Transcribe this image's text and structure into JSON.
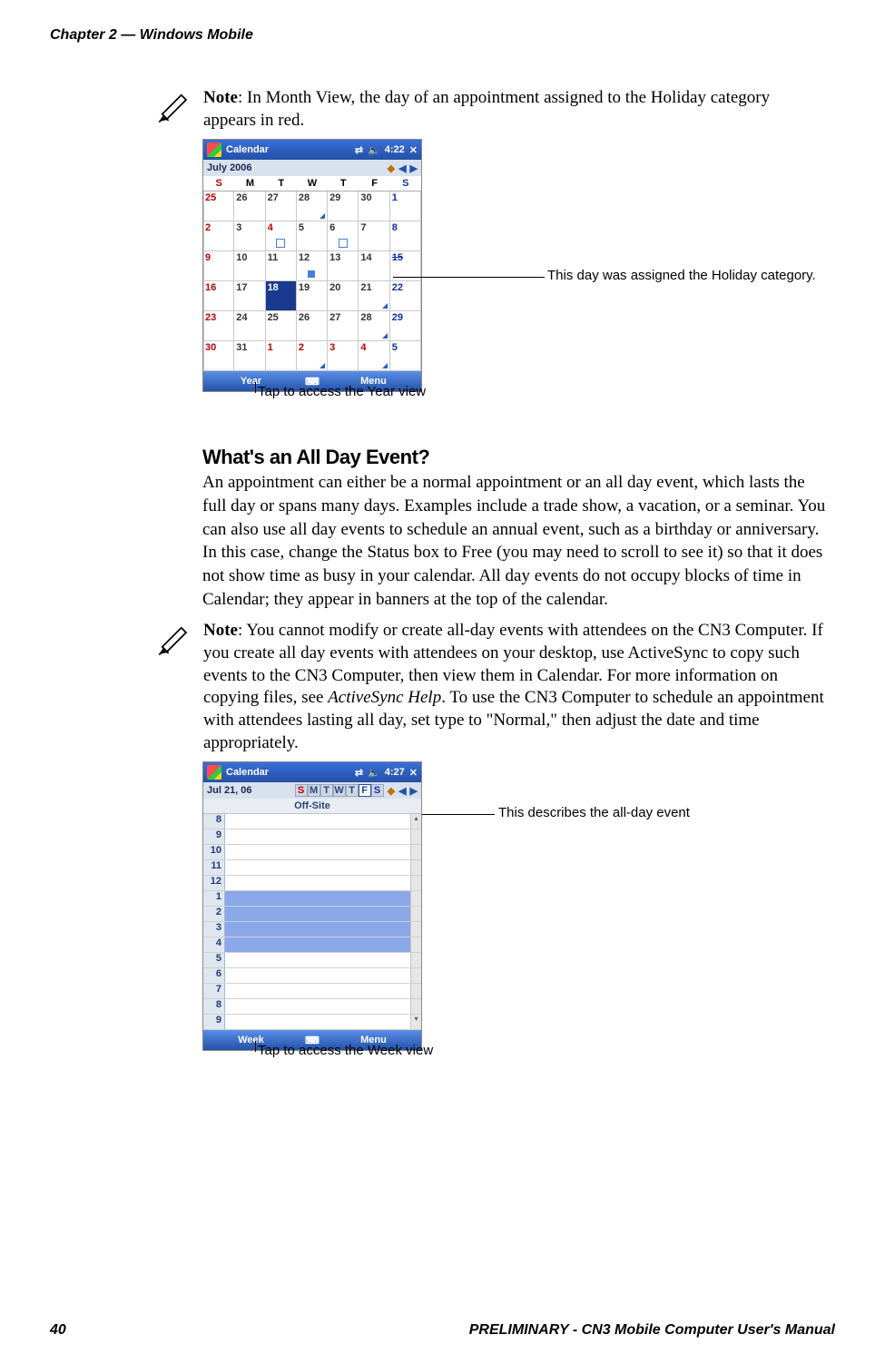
{
  "header": "Chapter 2 — Windows Mobile",
  "footer_left": "40",
  "footer_right": "PRELIMINARY - CN3 Mobile Computer User's Manual",
  "note1_prefix": "Note",
  "note1_body": ": In Month View, the day of an appointment assigned to the Holiday category appears in red.",
  "fig1": {
    "titlebar_app": "Calendar",
    "titlebar_time": "4:22",
    "month_label": "July 2006",
    "dows": [
      "S",
      "M",
      "T",
      "W",
      "T",
      "F",
      "S"
    ],
    "grid": [
      [
        {
          "n": "25",
          "cls": "other"
        },
        {
          "n": "26"
        },
        {
          "n": "27"
        },
        {
          "n": "28",
          "tri": true
        },
        {
          "n": "29"
        },
        {
          "n": "30"
        },
        {
          "n": "1",
          "cls": "blue"
        }
      ],
      [
        {
          "n": "2",
          "cls": "red"
        },
        {
          "n": "3"
        },
        {
          "n": "4",
          "cls": "red",
          "sqo": true
        },
        {
          "n": "5"
        },
        {
          "n": "6",
          "sqo": true
        },
        {
          "n": "7"
        },
        {
          "n": "8",
          "cls": "blue"
        }
      ],
      [
        {
          "n": "9",
          "cls": "red"
        },
        {
          "n": "10"
        },
        {
          "n": "11"
        },
        {
          "n": "12",
          "sq": true
        },
        {
          "n": "13"
        },
        {
          "n": "14"
        },
        {
          "n": "15",
          "cls": "blue",
          "strike": true
        }
      ],
      [
        {
          "n": "16",
          "cls": "red"
        },
        {
          "n": "17"
        },
        {
          "n": "18",
          "cls": "sel"
        },
        {
          "n": "19"
        },
        {
          "n": "20"
        },
        {
          "n": "21",
          "tri": true
        },
        {
          "n": "22",
          "cls": "blue"
        }
      ],
      [
        {
          "n": "23",
          "cls": "red"
        },
        {
          "n": "24"
        },
        {
          "n": "25"
        },
        {
          "n": "26"
        },
        {
          "n": "27"
        },
        {
          "n": "28",
          "tri": true
        },
        {
          "n": "29",
          "cls": "blue"
        }
      ],
      [
        {
          "n": "30",
          "cls": "red"
        },
        {
          "n": "31"
        },
        {
          "n": "1",
          "cls": "other"
        },
        {
          "n": "2",
          "cls": "other",
          "tri": true
        },
        {
          "n": "3",
          "cls": "other"
        },
        {
          "n": "4",
          "cls": "other",
          "tri": true
        },
        {
          "n": "5",
          "cls": "blue"
        }
      ]
    ],
    "bottom_left": "Year",
    "bottom_right": "Menu",
    "callout_right": "This day was assigned the Holiday category.",
    "caption": "Tap to access the Year view"
  },
  "heading2": "What's an All Day Event?",
  "para2": "An appointment can either be a normal appointment or an all day event, which lasts the full day or spans many days. Examples include a trade show, a vacation, or a seminar. You can also use all day events to schedule an annual event, such as a birthday or anniversary. In this case, change the Status box to Free (you may need to scroll to see it) so that it does not show time as busy in your calendar. All day events do not occupy blocks of time in Calendar; they appear in banners at the top of the calendar.",
  "note2_prefix": "Note",
  "note2_body_a": ": You cannot modify or create all-day events with attendees on the CN3 Computer. If you create all day events with attendees on your desktop, use ActiveSync to copy such events to the CN3 Computer, then view them in Calendar. For more information on copying files, see ",
  "note2_em": "ActiveSync Help",
  "note2_body_b": ". To use the CN3 Computer to schedule an appointment with attendees lasting all day, set type to \"Normal,\" then adjust the date and time appropriately.",
  "fig2": {
    "titlebar_app": "Calendar",
    "titlebar_time": "4:27",
    "date_label": "Jul  21, 06",
    "dows": [
      "S",
      "M",
      "T",
      "W",
      "T",
      "F",
      "S"
    ],
    "allday_label": "Off-Site",
    "hours": [
      "8",
      "9",
      "10",
      "11",
      "12",
      "1",
      "2",
      "3",
      "4",
      "5",
      "6",
      "7",
      "8",
      "9"
    ],
    "busy_from": 5,
    "busy_to": 8,
    "bottom_left": "Week",
    "bottom_right": "Menu",
    "callout_right": "This describes the all-day event",
    "caption": "Tap to access the Week view"
  }
}
